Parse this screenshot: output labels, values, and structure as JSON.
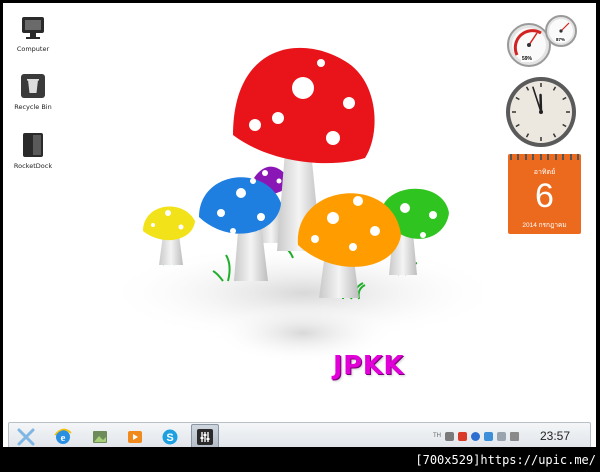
{
  "desktop_icons": [
    {
      "label": "Computer",
      "icon": "computer-icon"
    },
    {
      "label": "Recycle Bin",
      "icon": "recycle-bin-icon"
    },
    {
      "label": "RocketDock",
      "icon": "rocketdock-icon"
    }
  ],
  "wallpaper": {
    "text": "JPKK",
    "text_color": "#e100d8",
    "mushroom_colors": [
      "#e8141a",
      "#8a16b5",
      "#1f7fe0",
      "#f2e21a",
      "#ff9d00",
      "#2fc41f"
    ]
  },
  "gadgets": {
    "cpu_meter": {
      "cpu_percent": "59%",
      "ram_percent": "87%"
    },
    "calendar": {
      "weekday": "อาทิตย์",
      "day": "6",
      "month_year": "2014 กรกฎาคม",
      "accent": "#ec6a1e"
    },
    "analog_clock": {
      "hour": 11,
      "minute": 57
    }
  },
  "taskbar": {
    "buttons": [
      {
        "name": "start-x-icon",
        "active": false
      },
      {
        "name": "internet-explorer-icon",
        "active": false
      },
      {
        "name": "photo-viewer-icon",
        "active": false
      },
      {
        "name": "media-player-icon",
        "active": false
      },
      {
        "name": "skype-icon",
        "active": false
      },
      {
        "name": "mixer-icon",
        "active": true
      }
    ],
    "language": "TH",
    "time": "23:57"
  },
  "footer": {
    "text": "[700x529]https://upic.me/"
  }
}
